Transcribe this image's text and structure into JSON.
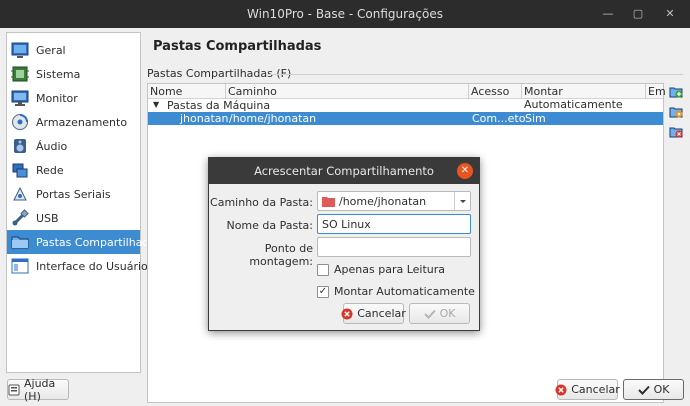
{
  "window": {
    "title": "Win10Pro - Base - Configurações"
  },
  "sidebar": {
    "items": [
      {
        "label": "Geral",
        "icon": "general-icon"
      },
      {
        "label": "Sistema",
        "icon": "system-icon"
      },
      {
        "label": "Monitor",
        "icon": "monitor-icon"
      },
      {
        "label": "Armazenamento",
        "icon": "storage-icon"
      },
      {
        "label": "Áudio",
        "icon": "audio-icon"
      },
      {
        "label": "Rede",
        "icon": "network-icon"
      },
      {
        "label": "Portas Seriais",
        "icon": "serial-ports-icon"
      },
      {
        "label": "USB",
        "icon": "usb-icon"
      },
      {
        "label": "Pastas Compartilhadas",
        "icon": "shared-folder-icon",
        "selected": true
      },
      {
        "label": "Interface do Usuário",
        "icon": "user-interface-icon"
      }
    ]
  },
  "main": {
    "title": "Pastas Compartilhadas",
    "group_label": "Pastas Compartilhadas (F)",
    "table": {
      "columns": [
        "Nome",
        "Caminho",
        "Acesso",
        "Montar Automaticamente",
        "Em"
      ],
      "group_row": "Pastas da Máquina",
      "rows": [
        {
          "name": "jhonatan",
          "path": "/home/jhonatan",
          "access": "Com...eto",
          "auto": "Sim",
          "at": ""
        }
      ]
    }
  },
  "footer": {
    "help": "Ajuda (H)",
    "cancel": "Cancelar",
    "ok": "OK"
  },
  "dialog": {
    "title": "Acrescentar Compartilhamento",
    "path_label": "Caminho da Pasta:",
    "path_value": "/home/jhonatan",
    "name_label": "Nome da Pasta:",
    "name_value": "SO Linux",
    "mount_label": "Ponto de montagem:",
    "mount_value": "",
    "readonly_label": "Apenas para Leitura",
    "readonly_checked": false,
    "automount_label": "Montar Automaticamente",
    "automount_checked": true,
    "cancel": "Cancelar",
    "ok": "OK"
  },
  "colors": {
    "accent": "#3d8bd0",
    "close": "#e95420",
    "cancel_icon": "#d9342b",
    "folder": "#e05a5a"
  }
}
